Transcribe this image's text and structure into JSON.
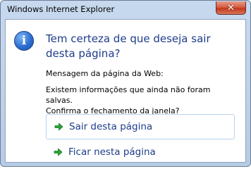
{
  "window": {
    "title": "Windows Internet Explorer",
    "close_symbol": "✕",
    "close_icon": "close-icon"
  },
  "dialog": {
    "icon": "info-icon",
    "icon_glyph": "i",
    "headline": "Tem certeza de que deseja sair desta página?",
    "source_label": "Mensagem da página da Web:",
    "message_line1": "Existem informações que ainda não foram salvas.",
    "message_line2": "Confirma o fechamento da janela?"
  },
  "options": [
    {
      "label": "Sair desta página",
      "icon": "green-arrow-icon",
      "focused": true
    },
    {
      "label": "Ficar nesta página",
      "icon": "green-arrow-icon",
      "focused": false
    }
  ],
  "colors": {
    "headline": "#1e3c8c",
    "arrow": "#2aa136",
    "frame": "#b6cbe4",
    "close_button": "#c4381c"
  }
}
